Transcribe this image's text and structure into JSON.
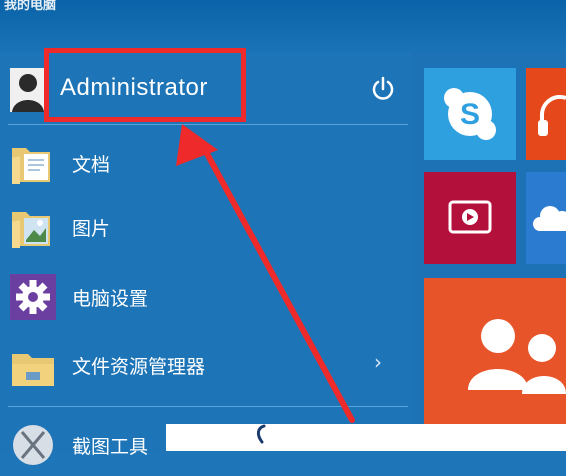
{
  "window": {
    "title": "我的电脑"
  },
  "user": {
    "name": "Administrator"
  },
  "menu_items": [
    {
      "label": "文档"
    },
    {
      "label": "图片"
    },
    {
      "label": "电脑设置"
    },
    {
      "label": "文件资源管理器",
      "chevron": "›"
    },
    {
      "label": "截图工具"
    }
  ],
  "icons": {
    "user": "user-avatar-icon",
    "power": "power-icon",
    "documents": "folder-documents-icon",
    "pictures": "folder-pictures-icon",
    "settings": "gear-icon",
    "explorer": "file-explorer-icon",
    "snipping": "snipping-tool-icon",
    "skype": "skype-icon",
    "music": "headphones-icon",
    "video": "video-play-icon",
    "onedrive": "cloud-icon",
    "people": "people-icon"
  },
  "colors": {
    "accent_blue": "#1d74b7",
    "highlight_red": "#ef2a2a",
    "skype_tile": "#2ea0e0",
    "music_tile": "#e4481b",
    "video_tile": "#b4103c",
    "onedrive_tile": "#2b7bd0",
    "people_tile": "#e8542a"
  }
}
